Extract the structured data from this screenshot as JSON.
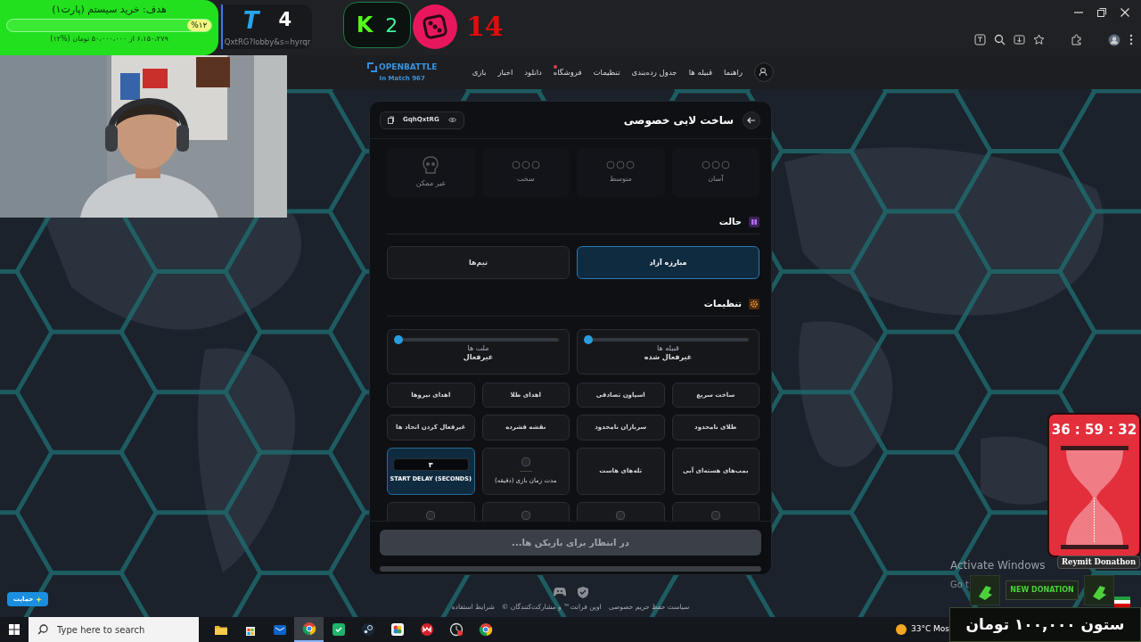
{
  "overlay": {
    "goal": {
      "title": "هدف: خرید سیستم (پارت۱)",
      "level": 0.12,
      "percent": "%۱۲",
      "progress": "۶،۱۵۰،۲۷۹ از ۵۰،۰۰۰،۰۰۰ تومان (%۱۲)"
    },
    "t_counter": {
      "logo": "T",
      "count": "4",
      "caption": "QxtRG?lobby&s=hyrqr"
    },
    "k_counter": {
      "logo": "K",
      "count": "2"
    },
    "dice_counter": {
      "count": "14"
    },
    "timer": {
      "time": "36 : 59 : 32",
      "label": "Reymit Donathon"
    },
    "donation": {
      "banner": "NEW DONATION",
      "amount": "ستون ۱۰۰,۰۰۰ تومان"
    }
  },
  "site": {
    "logo": "OPENBATTLE",
    "players": "967 In Match",
    "nav": [
      {
        "label": "راهنما",
        "badge": false
      },
      {
        "label": "قبیله ها",
        "badge": false
      },
      {
        "label": "جدول رده‌بندی",
        "badge": false
      },
      {
        "label": "تنظیمات",
        "badge": false
      },
      {
        "label": "فروشگاه",
        "badge": true
      },
      {
        "label": "دانلود",
        "badge": false
      },
      {
        "label": "اخبار",
        "badge": false
      },
      {
        "label": "بازی",
        "badge": false
      }
    ]
  },
  "lobby": {
    "title": "ساخت لابی خصوصی",
    "code": "GqhQxtRG",
    "difficulties": [
      {
        "label": "آسان",
        "kind": "faces"
      },
      {
        "label": "متوسط",
        "kind": "faces"
      },
      {
        "label": "سخت",
        "kind": "faces"
      },
      {
        "label": "غیر ممکن",
        "kind": "skull"
      }
    ],
    "mode": {
      "title": "حالت",
      "options": [
        {
          "label": "مبارزه آزاد",
          "selected": true
        },
        {
          "label": "تیم‌ها",
          "selected": false
        }
      ]
    },
    "settings": {
      "title": "تنظیمات",
      "sliders": [
        {
          "label": "قبیله ها",
          "value": "غیرفعال شده",
          "level": 0
        },
        {
          "label": "ملت ها",
          "value": "غیرفعال",
          "level": 0
        }
      ],
      "options": [
        {
          "kind": "toggle",
          "label": "ساخت سریع"
        },
        {
          "kind": "toggle",
          "label": "اسپاون تصادفی"
        },
        {
          "kind": "toggle",
          "label": "اهدای طلا"
        },
        {
          "kind": "toggle",
          "label": "اهدای نیروها"
        },
        {
          "kind": "toggle",
          "label": "طلای نامحدود"
        },
        {
          "kind": "toggle",
          "label": "سربازان نامحدود"
        },
        {
          "kind": "toggle",
          "label": "نقشه فشرده"
        },
        {
          "kind": "toggle",
          "label": "غیرفعال کردن اتحاد ها"
        },
        {
          "kind": "toggle",
          "label": "بمب‌های هسته‌ای آبی"
        },
        {
          "kind": "toggle",
          "label": "تله‌های هاست"
        },
        {
          "kind": "checkbox_field",
          "label": "مدت زمان بازی (دقیقه)",
          "checked": false
        },
        {
          "kind": "number_field",
          "label": "START DELAY (SECONDS)",
          "value": "۳",
          "selected": true
        },
        {
          "kind": "checkbox",
          "checked": false
        },
        {
          "kind": "checkbox",
          "checked": false
        },
        {
          "kind": "checkbox",
          "checked": false
        },
        {
          "kind": "checkbox",
          "checked": false
        }
      ]
    },
    "submit": {
      "label": "در انتظار برای بازیکن ها...",
      "disabled": true
    }
  },
  "footer": {
    "support": "حمایت",
    "links": [
      "سیاست حفظ حریم خصوصی",
      "اوپن فرانت™ و مشارکت‌کنندگان ©",
      "شرایط استفاده"
    ]
  },
  "taskbar": {
    "search_placeholder": "Type here to search",
    "apps": [
      {
        "kind": "folder",
        "active": false
      },
      {
        "kind": "store",
        "active": false
      },
      {
        "kind": "mail",
        "active": false
      },
      {
        "kind": "browser",
        "active": true
      },
      {
        "kind": "shield",
        "active": false
      },
      {
        "kind": "steam",
        "active": false
      },
      {
        "kind": "photos",
        "active": false
      },
      {
        "kind": "game",
        "active": false
      },
      {
        "kind": "clock",
        "active": false
      },
      {
        "kind": "browser",
        "active": false
      }
    ],
    "weather": "33°C Mos"
  },
  "activation": {
    "title": "Activate Windows",
    "hint": "Go t"
  }
}
